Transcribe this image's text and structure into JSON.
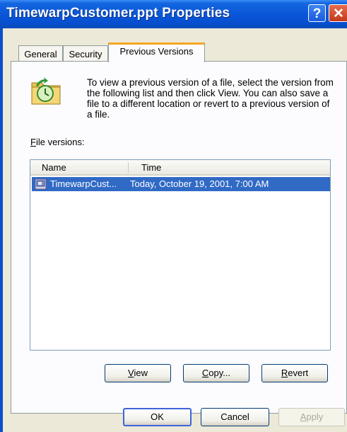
{
  "window": {
    "title": "TimewarpCustomer.ppt Properties",
    "help_icon": "?",
    "close_icon": "✕"
  },
  "tabs": [
    {
      "label": "General",
      "active": false
    },
    {
      "label": "Security",
      "active": false
    },
    {
      "label": "Previous Versions",
      "active": true
    }
  ],
  "info": {
    "text": "To view a previous version of a file, select the version from the following list and then click View.  You can also save a file to a different location or revert to a previous version of a file.",
    "icon": "folder-clock-icon"
  },
  "versions": {
    "label_first": "F",
    "label_rest": "ile versions:",
    "columns": [
      "Name",
      "Time"
    ],
    "rows": [
      {
        "name": "TimewarpCust...",
        "time": "Today, October 19, 2001, 7:00 AM",
        "selected": true
      }
    ]
  },
  "actions": {
    "view_key": "V",
    "view_rest": "iew",
    "copy_key": "C",
    "copy_rest": "opy...",
    "revert_key": "R",
    "revert_rest": "evert"
  },
  "dialog_buttons": {
    "ok": "OK",
    "cancel": "Cancel",
    "apply_key": "A",
    "apply_rest": "pply",
    "apply_disabled": true
  },
  "colors": {
    "titlebar": "#0a56d8",
    "selection": "#316ac5",
    "tab_highlight": "#f5a623",
    "dialog_bg": "#ece9d8"
  }
}
